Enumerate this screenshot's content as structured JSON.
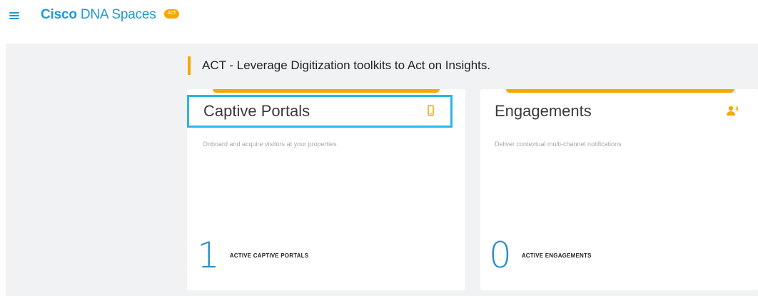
{
  "topbar": {
    "menu_icon": "hamburger-menu-icon",
    "brand_bold": "Cisco",
    "brand_rest": " DNA Spaces",
    "badge": "ACT"
  },
  "section": {
    "title": "ACT - Leverage Digitization toolkits to Act on Insights."
  },
  "cards": [
    {
      "title": "Captive Portals",
      "icon": "mobile-phone-icon",
      "description": "Onboard and acquire visitors at your properties",
      "count": "1",
      "count_label": "ACTIVE CAPTIVE PORTALS",
      "highlighted": true
    },
    {
      "title": "Engagements",
      "icon": "user-notification-icon",
      "description": "Deliver contextual multi-channel notifications",
      "count": "0",
      "count_label": "ACTIVE ENGAGEMENTS",
      "highlighted": false
    }
  ],
  "colors": {
    "brand_blue": "#1a9ad6",
    "accent_orange": "#f6a800",
    "highlight_cyan": "#2bb5e8",
    "stat_blue": "#2a8fd0",
    "content_bg": "#f1f2f3"
  }
}
